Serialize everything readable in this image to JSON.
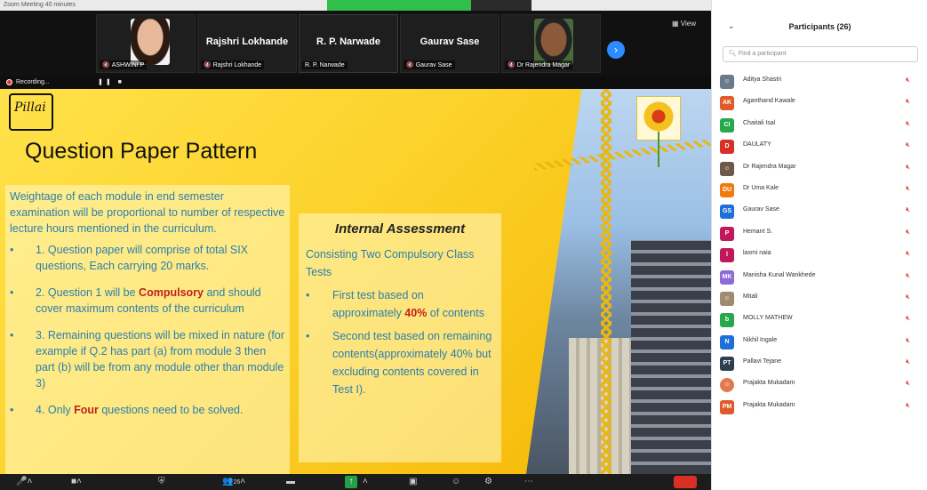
{
  "window": {
    "title": "Zoom Meeting 40 minutes"
  },
  "video_strip": {
    "tiles": [
      {
        "name": "",
        "label": "ASHWINI P"
      },
      {
        "name": "Rajshri Lokhande",
        "label": "Rajshri Lokhande"
      },
      {
        "name": "R. P. Narwade",
        "label": "R. P. Narwade"
      },
      {
        "name": "Gaurav Sase",
        "label": "Gaurav Sase"
      },
      {
        "name": "",
        "label": "Dr Rajendra Magar"
      }
    ],
    "view_label": "View"
  },
  "recording": {
    "label": "Recording..."
  },
  "slide": {
    "signature": "Pillai",
    "title": "Question Paper Pattern",
    "left_intro": "Weightage of each module in end semester examination will be proportional to number of respective lecture hours mentioned in the curriculum.",
    "left_points": [
      {
        "pre": "1. Question paper will comprise of total SIX questions, Each carrying 20 marks.",
        "hl": "",
        "post": ""
      },
      {
        "pre": "2. Question 1 will be ",
        "hl": "Compulsory",
        "post": " and should cover maximum contents of the curriculum"
      },
      {
        "pre": "3. Remaining questions will be mixed in nature (for example if Q.2 has part (a) from module 3 then part (b) will be from any module other than module 3)",
        "hl": "",
        "post": ""
      },
      {
        "pre": "4. Only ",
        "hl": "Four",
        "post": " questions need to be solved."
      }
    ],
    "right_title": "Internal Assessment",
    "right_intro": "Consisting Two Compulsory Class Tests",
    "right_points": [
      {
        "pre": "First test based on approximately ",
        "hl": "40%",
        "post": " of contents"
      },
      {
        "pre": "Second test based on remaining contents(approximately 40% but excluding contents covered in Test I).",
        "hl": "",
        "post": ""
      }
    ]
  },
  "panel": {
    "title": "Participants (26)",
    "search_placeholder": "Find a participant",
    "participants": [
      {
        "name": "Aditya Shastri",
        "initials": "",
        "color": "#6b7a8a"
      },
      {
        "name": "Aganthand Kawale",
        "initials": "AK",
        "color": "#e05a2b"
      },
      {
        "name": "Chaitali Isal",
        "initials": "CI",
        "color": "#27a84a"
      },
      {
        "name": "DAULATY",
        "initials": "D",
        "color": "#d93025"
      },
      {
        "name": "Dr Rajendra Magar",
        "initials": "",
        "color": "#6b5a48"
      },
      {
        "name": "Dr Uma Kale",
        "initials": "DU",
        "color": "#f07a10"
      },
      {
        "name": "Gaurav Sase",
        "initials": "GS",
        "color": "#1e6fd9"
      },
      {
        "name": "Hemant S.",
        "initials": "P",
        "color": "#c2185b"
      },
      {
        "name": "laxmi naia",
        "initials": "l",
        "color": "#c2185b"
      },
      {
        "name": "Manisha Kunal Wankhede",
        "initials": "MK",
        "color": "#8e6ad6"
      },
      {
        "name": "Mitali",
        "initials": "",
        "color": "#a08a70"
      },
      {
        "name": "MOLLY MATHEW",
        "initials": "b",
        "color": "#27a84a"
      },
      {
        "name": "Nikhil Ingale",
        "initials": "N",
        "color": "#1e6fd9"
      },
      {
        "name": "Pallavi Tejane",
        "initials": "PT",
        "color": "#2c3e50"
      },
      {
        "name": "Prajakta Mukadam",
        "initials": "",
        "color": "#e07b50"
      },
      {
        "name": "Prajakta Mukadam",
        "initials": "PM",
        "color": "#e05a2b"
      }
    ]
  },
  "toolbar": {
    "participants_count": "26"
  }
}
